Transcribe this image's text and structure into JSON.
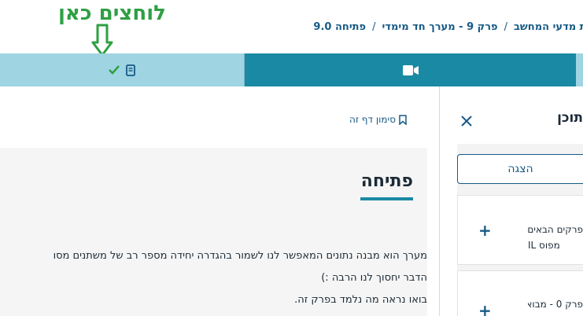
{
  "annotation": {
    "text": "לוחצים כאן",
    "color": "#2ea043"
  },
  "breadcrumb": {
    "course": "ת יסודות מדעי המחשב C#",
    "chapter": "פרק 9 - מערך חד מימדי",
    "page": "9.0 פתיחה",
    "separator": "/"
  },
  "tabs": {
    "reading": {
      "icon": "book-icon",
      "status_icon": "check-icon",
      "active_color": "#9fd4e3"
    },
    "video": {
      "icon": "video-camera-icon",
      "color": "#1a89a3"
    }
  },
  "bookmark": {
    "label": "סימון דף זה",
    "icon": "bookmark-icon"
  },
  "content": {
    "title": "פתיחה",
    "paragraph1": "מערך הוא מבנה נתונים המאפשר לנו לשמור בהגדרה יחידה מספר רב של משתנים מסו",
    "paragraph2": "הדבר יחסוך לנו הרבה :)",
    "paragraph3": "בואו נראה מה נלמד בפרק זה."
  },
  "sidebar": {
    "title": "תוכן הקורס",
    "close_icon": "close-icon",
    "show_button": "הצגה",
    "cards": [
      {
        "line1": "פרקים הבאים",
        "line2": "מפוס IL",
        "expand": "+"
      },
      {
        "line1": "פרק 0 - מבוא",
        "expand": "+"
      }
    ]
  },
  "colors": {
    "brand_dark": "#175a86",
    "teal": "#1a89a3",
    "teal_light": "#9fd4e3",
    "success": "#2ea043"
  }
}
